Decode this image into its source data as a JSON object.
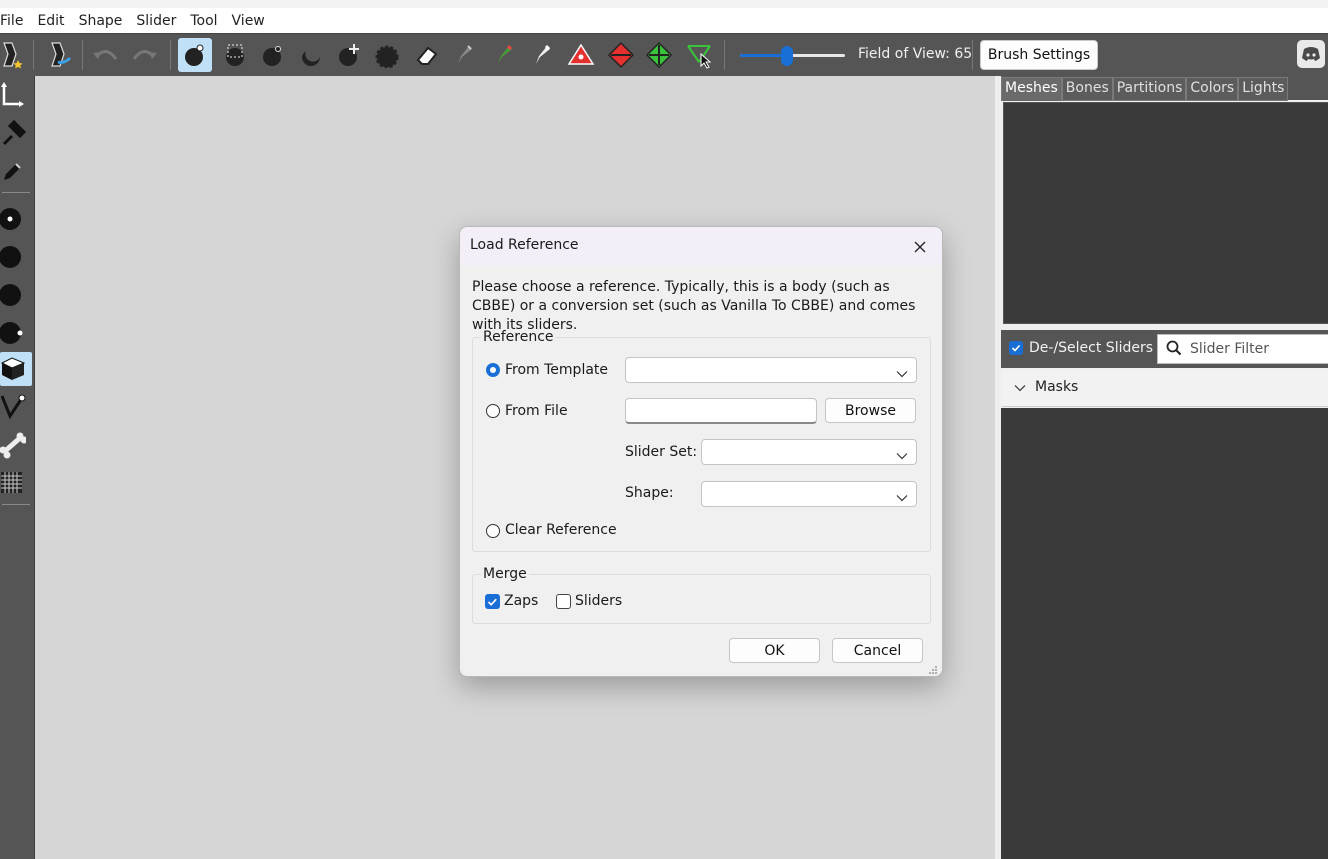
{
  "menubar": {
    "items": [
      "File",
      "Edit",
      "Shape",
      "Slider",
      "Tool",
      "View"
    ]
  },
  "toolbar": {
    "field_of_view_label": "Field of View: 65",
    "field_of_view_fraction": 0.45,
    "brush_settings_label": "Brush Settings"
  },
  "right_panel": {
    "tabs": [
      "Meshes",
      "Bones",
      "Partitions",
      "Colors",
      "Lights"
    ],
    "active_tab": "Meshes",
    "deselect_sliders_label": "De-/Select Sliders",
    "deselect_sliders_checked": true,
    "slider_filter_placeholder": "Slider Filter",
    "masks_label": "Masks"
  },
  "dialog": {
    "title": "Load Reference",
    "description": "Please choose a reference. Typically, this is a body (such as CBBE) or a conversion set (such as Vanilla To CBBE) and comes with its sliders.",
    "reference_group_title": "Reference",
    "from_template_label": "From Template",
    "from_template_value": "",
    "from_file_label": "From File",
    "from_file_value": "",
    "browse_label": "Browse",
    "slider_set_label": "Slider Set:",
    "slider_set_value": "",
    "shape_label": "Shape:",
    "shape_value": "",
    "clear_reference_label": "Clear Reference",
    "selected_option": "From Template",
    "merge_group_title": "Merge",
    "zaps_label": "Zaps",
    "zaps_checked": true,
    "sliders_label": "Sliders",
    "sliders_checked": false,
    "ok_label": "OK",
    "cancel_label": "Cancel"
  },
  "colors": {
    "accent": "#1a6fd6",
    "toolbar_bg": "#555555",
    "canvas_bg": "#d6d6d6",
    "panel_dark": "#3a3a3a"
  }
}
